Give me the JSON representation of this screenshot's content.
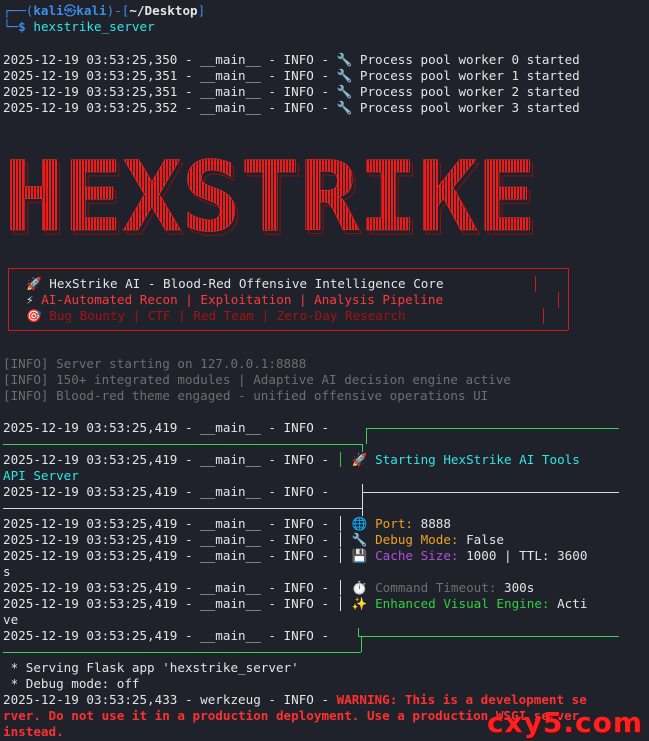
{
  "prompt": {
    "user": "kali",
    "at": "㉿",
    "host": "kali",
    "dir": "~/Desktop",
    "dollar": "$",
    "command": "hexstrike_server"
  },
  "pool_logs": [
    "2025-12-19 03:53:25,350 - __main__ - INFO - 🔧 Process pool worker 0 started",
    "2025-12-19 03:53:25,351 - __main__ - INFO - 🔧 Process pool worker 1 started",
    "2025-12-19 03:53:25,351 - __main__ - INFO - 🔧 Process pool worker 2 started",
    "2025-12-19 03:53:25,352 - __main__ - INFO - 🔧 Process pool worker 3 started"
  ],
  "banner_text": "HEXSTRIKE",
  "info_box": {
    "line1_icon": "🚀",
    "line1": "HexStrike AI - Blood-Red Offensive Intelligence Core",
    "line2_icon": "⚡",
    "line2": "AI-Automated Recon | Exploitation | Analysis Pipeline",
    "line3_icon": "🎯",
    "line3": "Bug Bounty | CTF | Red Team | Zero-Day Research"
  },
  "server_info": [
    "[INFO] Server starting on 127.0.0.1:8888",
    "[INFO] 150+ integrated modules | Adaptive AI decision engine active",
    "[INFO] Blood-red theme engaged - unified offensive operations UI"
  ],
  "log_prefix": "2025-12-19 03:53:25,419 - __main__ - INFO -",
  "status": {
    "start_icon": "🚀",
    "start_line1": "Starting HexStrike AI Tools",
    "start_line2": "API Server",
    "port_icon": "🌐",
    "port_label": "Port:",
    "port_value": "8888",
    "debug_icon": "🔧",
    "debug_label": "Debug Mode:",
    "debug_value": "False",
    "cache_icon": "💾",
    "cache_label": "Cache Size:",
    "cache_value": "1000 | TTL: 3600",
    "cache_wrap": "s",
    "timeout_icon": "⏱️",
    "timeout_label": "Command Timeout:",
    "timeout_value": "300s",
    "visual_icon": "✨",
    "visual_label": "Enhanced Visual Engine:",
    "visual_value": "Acti",
    "visual_wrap": "ve"
  },
  "flask": {
    "serving": " * Serving Flask app 'hexstrike_server'",
    "debug": " * Debug mode: off",
    "werkzeug_prefix": "2025-12-19 03:53:25,433 - werkzeug - INFO - ",
    "warning1": "WARNING: This is a development se",
    "warning2": "rver. Do not use it in a production deployment. Use a production WSGI server",
    "warning3": "instead."
  },
  "watermark": "cxy5.com"
}
